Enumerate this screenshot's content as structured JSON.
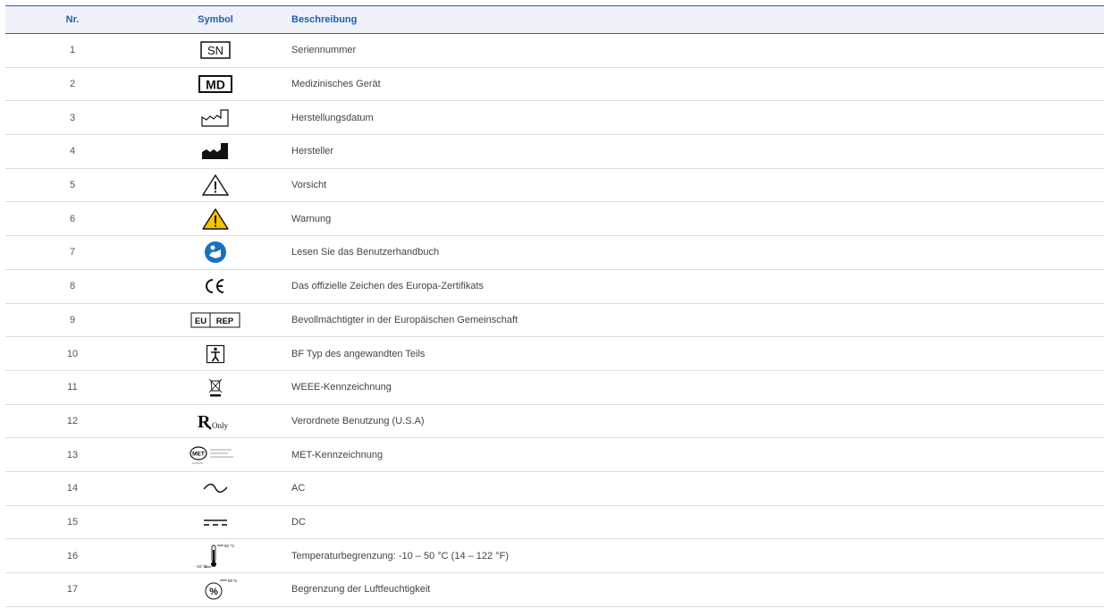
{
  "table": {
    "headers": {
      "nr": "Nr.",
      "symbol": "Symbol",
      "description": "Beschreibung"
    },
    "rows": [
      {
        "nr": "1",
        "icon": "sn-icon",
        "sym_text": "SN",
        "description": "Seriennummer"
      },
      {
        "nr": "2",
        "icon": "md-icon",
        "sym_text": "MD",
        "description": "Medizinisches Gerät"
      },
      {
        "nr": "3",
        "icon": "date-of-manufacture-icon",
        "description": "Herstellungsdatum"
      },
      {
        "nr": "4",
        "icon": "manufacturer-icon",
        "description": "Hersteller"
      },
      {
        "nr": "5",
        "icon": "caution-icon",
        "description": "Vorsicht"
      },
      {
        "nr": "6",
        "icon": "warning-icon",
        "description": "Warnung"
      },
      {
        "nr": "7",
        "icon": "read-manual-icon",
        "description": "Lesen Sie das Benutzerhandbuch"
      },
      {
        "nr": "8",
        "icon": "ce-mark-icon",
        "sym_text": "CE",
        "description": "Das offizielle Zeichen des Europa-Zertifikats"
      },
      {
        "nr": "9",
        "icon": "eu-rep-icon",
        "sym_text_a": "EU",
        "sym_text_b": "REP",
        "description": "Bevollmächtigter in der Europäischen Gemeinschaft"
      },
      {
        "nr": "10",
        "icon": "bf-type-icon",
        "description": "BF Typ des angewandten Teils"
      },
      {
        "nr": "11",
        "icon": "weee-icon",
        "description": "WEEE-Kennzeichnung"
      },
      {
        "nr": "12",
        "icon": "rx-only-icon",
        "sym_text": "Only",
        "description": "Verordnete Benutzung (U.S.A)"
      },
      {
        "nr": "13",
        "icon": "met-mark-icon",
        "sym_text": "MET",
        "description": "MET-Kennzeichnung"
      },
      {
        "nr": "14",
        "icon": "ac-icon",
        "description": "AC"
      },
      {
        "nr": "15",
        "icon": "dc-icon",
        "description": "DC"
      },
      {
        "nr": "16",
        "icon": "temperature-limit-icon",
        "sym_text_a": "50 °C",
        "sym_text_b": "-10 °C",
        "description": "Temperaturbegrenzung: -10 – 50 °C (14 – 122 °F)"
      },
      {
        "nr": "17",
        "icon": "humidity-limit-icon",
        "sym_text_a": "80 %",
        "sym_text_b": "%",
        "description": "Begrenzung der Luftfeuchtigkeit"
      }
    ]
  },
  "colors": {
    "accent": "#1f5fae",
    "header_bg": "#eef2f8",
    "warning_yellow": "#f5c400",
    "manual_blue": "#1a6fc1"
  }
}
